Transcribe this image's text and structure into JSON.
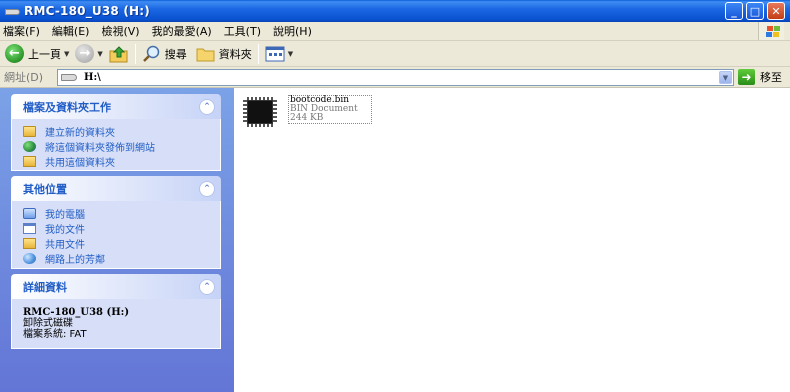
{
  "window": {
    "title": "RMC-180_U38 (H:)",
    "buttons": {
      "minimize": "_",
      "maximize": "□",
      "close": "✕"
    }
  },
  "menu": [
    "檔案(F)",
    "編輯(E)",
    "檢視(V)",
    "我的最愛(A)",
    "工具(T)",
    "說明(H)"
  ],
  "toolbar": {
    "back_label": "上一頁",
    "search_label": "搜尋",
    "folders_label": "資料夾",
    "icons": [
      "back-icon",
      "forward-icon",
      "up-folder-icon",
      "search-icon",
      "folders-icon",
      "views-icon"
    ]
  },
  "address": {
    "label": "網址(D)",
    "value": "H:\\",
    "go_label": "移至"
  },
  "task_pane": {
    "file_tasks": {
      "title": "檔案及資料夾工作",
      "items": [
        "建立新的資料夾",
        "將這個資料夾發佈到網站",
        "共用這個資料夾"
      ]
    },
    "other_places": {
      "title": "其他位置",
      "items": [
        "我的電腦",
        "我的文件",
        "共用文件",
        "網路上的芳鄰"
      ]
    },
    "details": {
      "title": "詳細資料",
      "name": "RMC-180_U38 (H:)",
      "type": "卸除式磁碟",
      "filesystem": "檔案系統: FAT"
    },
    "collapse_glyph": "⌃"
  },
  "files": [
    {
      "name": "bootcode.bin",
      "type": "BIN Document",
      "size": "244 KB"
    }
  ],
  "colors": {
    "titlebar": "#0a52d0",
    "taskpane_top": "#7ba2e7",
    "taskpane_bottom": "#6375d6",
    "panel_title": "#215dc6",
    "link": "#215dc6",
    "chrome": "#ece9d8"
  }
}
